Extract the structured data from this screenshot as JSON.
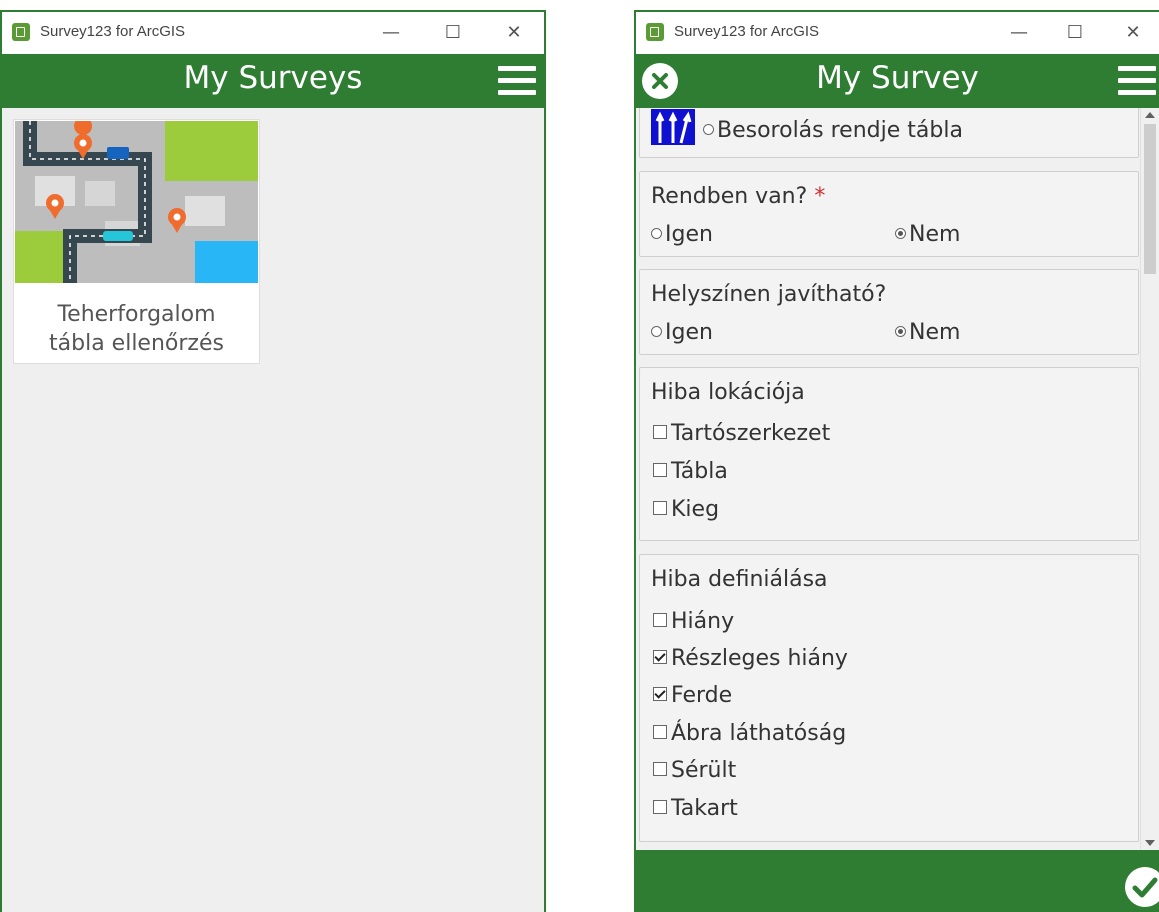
{
  "left_window": {
    "title": "Survey123 for ArcGIS",
    "controls": {
      "minimize": "—",
      "maximize": "☐",
      "close": "✕"
    },
    "appbar_title": "My Surveys",
    "surveys": [
      {
        "title_line1": "Teherforgalom",
        "title_line2": "tábla ellenőrzés"
      }
    ]
  },
  "right_window": {
    "title": "Survey123 for ArcGIS",
    "controls": {
      "minimize": "—",
      "maximize": "☐",
      "close": "✕"
    },
    "appbar_title": "My Survey",
    "form": {
      "sign_option": {
        "label": "Besorolás rendje tábla",
        "selected": false
      },
      "q_rendben": {
        "label": "Rendben van?",
        "required_mark": "*",
        "options": [
          {
            "label": "Igen",
            "selected": false
          },
          {
            "label": "Nem",
            "selected": true
          }
        ]
      },
      "q_javithato": {
        "label": "Helyszínen javítható?",
        "options": [
          {
            "label": "Igen",
            "selected": false
          },
          {
            "label": "Nem",
            "selected": true
          }
        ]
      },
      "q_lokacio": {
        "label": "Hiba lokációja",
        "options": [
          {
            "label": "Tartószerkezet",
            "checked": false
          },
          {
            "label": "Tábla",
            "checked": false
          },
          {
            "label": "Kieg",
            "checked": false
          }
        ]
      },
      "q_definialas": {
        "label": "Hiba definiálása",
        "options": [
          {
            "label": "Hiány",
            "checked": false
          },
          {
            "label": "Részleges hiány",
            "checked": true
          },
          {
            "label": "Ferde",
            "checked": true
          },
          {
            "label": "Ábra láthatóság",
            "checked": false
          },
          {
            "label": "Sérült",
            "checked": false
          },
          {
            "label": "Takart",
            "checked": false
          }
        ]
      }
    }
  },
  "colors": {
    "brand_green": "#2e7d32",
    "background": "#efefef",
    "required": "#d32f2f"
  }
}
